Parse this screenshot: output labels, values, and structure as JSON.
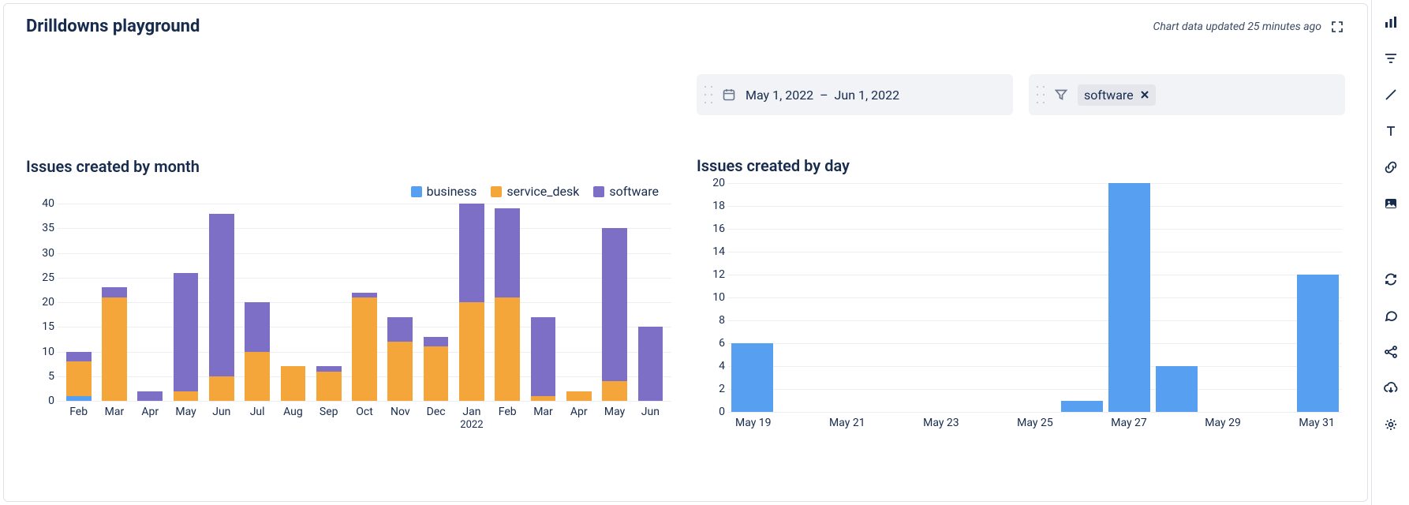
{
  "header": {
    "title": "Drilldowns playground",
    "status": "Chart data updated 25 minutes ago"
  },
  "controls": {
    "date_range": {
      "from": "May 1, 2022",
      "sep": "–",
      "to": "Jun 1, 2022"
    },
    "filter": {
      "tag": "software"
    }
  },
  "colors": {
    "business": "#579ff0",
    "service_desk": "#f4a63b",
    "software": "#7e6fc6"
  },
  "left_chart": {
    "title": "Issues created by month",
    "legend": [
      "business",
      "service_desk",
      "software"
    ]
  },
  "right_chart": {
    "title": "Issues created by day"
  },
  "chart_data": [
    {
      "id": "issues_by_month",
      "type": "bar",
      "stacked": true,
      "title": "Issues created by month",
      "ylabel": "",
      "xlabel": "",
      "ylim": [
        0,
        40
      ],
      "yticks": [
        0,
        5,
        10,
        15,
        20,
        25,
        30,
        35,
        40
      ],
      "categories": [
        "Feb",
        "Mar",
        "Apr",
        "May",
        "Jun",
        "Jul",
        "Aug",
        "Sep",
        "Oct",
        "Nov",
        "Dec",
        "Jan 2022",
        "Feb",
        "Mar",
        "Apr",
        "May",
        "Jun"
      ],
      "series": [
        {
          "name": "business",
          "values": [
            1,
            0,
            0,
            0,
            0,
            0,
            0,
            0,
            0,
            0,
            0,
            0,
            0,
            0,
            0,
            0,
            0
          ]
        },
        {
          "name": "service_desk",
          "values": [
            7,
            21,
            0,
            2,
            5,
            10,
            7,
            6,
            21,
            12,
            11,
            20,
            21,
            1,
            2,
            4,
            0
          ]
        },
        {
          "name": "software",
          "values": [
            2,
            2,
            2,
            24,
            33,
            10,
            0,
            1,
            1,
            5,
            2,
            20,
            18,
            16,
            0,
            31,
            15
          ]
        }
      ]
    },
    {
      "id": "issues_by_day",
      "type": "bar",
      "title": "Issues created by day",
      "ylabel": "",
      "xlabel": "",
      "ylim": [
        0,
        20
      ],
      "yticks": [
        0,
        2,
        4,
        6,
        8,
        10,
        12,
        14,
        16,
        18,
        20
      ],
      "color": "#579ff0",
      "categories": [
        "May 19",
        "May 20",
        "May 21",
        "May 22",
        "May 23",
        "May 24",
        "May 25",
        "May 26",
        "May 27",
        "May 28",
        "May 29",
        "May 30",
        "May 31"
      ],
      "tick_labels": [
        "May 19",
        "",
        "May 21",
        "",
        "May 23",
        "",
        "May 25",
        "",
        "May 27",
        "",
        "May 29",
        "",
        "May 31"
      ],
      "values": [
        6,
        0,
        0,
        0,
        0,
        0,
        0,
        1,
        20,
        4,
        0,
        0,
        12
      ]
    }
  ],
  "sidebar": {
    "tools": [
      "bar-chart-icon",
      "filter-icon",
      "pencil-icon",
      "text-icon",
      "link-icon",
      "image-icon"
    ],
    "tools2": [
      "refresh-icon",
      "comment-icon",
      "share-icon",
      "cloud-download-icon",
      "settings-icon"
    ]
  }
}
